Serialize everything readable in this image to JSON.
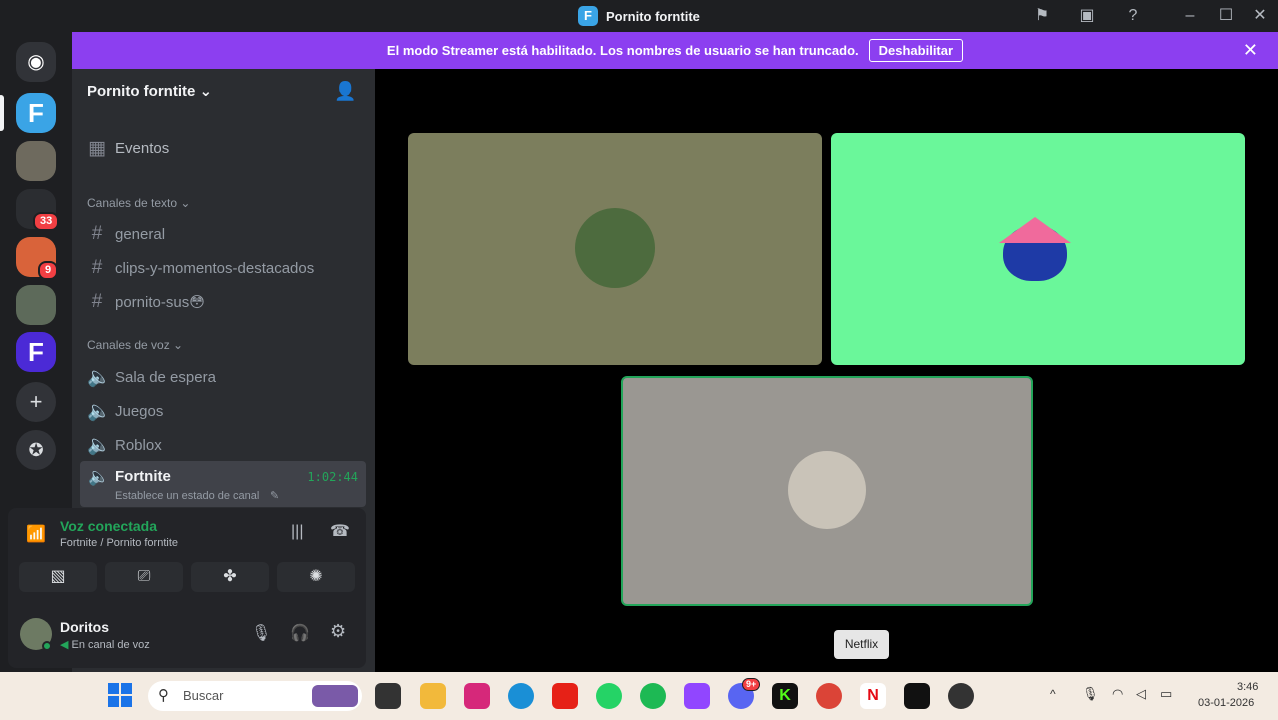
{
  "window": {
    "title": "Pornito forntite"
  },
  "banner": {
    "text": "El modo Streamer está habilitado. Los nombres de usuario se han truncado.",
    "button": "Deshabilitar"
  },
  "rail": {
    "badge_1": "33",
    "badge_2": "9"
  },
  "sidebar": {
    "server_name": "Pornito forntite",
    "events": "Eventos",
    "text_category": "Canales de texto",
    "text_channels": [
      "general",
      "clips-y-momentos-destacados",
      "pornito-sus😳"
    ],
    "voice_category": "Canales de voz",
    "voice_channels": [
      "Sala de espera",
      "Juegos",
      "Roblox"
    ],
    "active_channel": {
      "name": "Fortnite",
      "timer": "1:02:44",
      "status": "Establece un estado de canal"
    }
  },
  "voice_panel": {
    "status": "Voz conectada",
    "location": "Fortnite / Pornito forntite"
  },
  "user": {
    "name": "Doritos",
    "status": "En canal de voz"
  },
  "tooltip": "Netflix",
  "taskbar": {
    "search_placeholder": "Buscar",
    "discord_badge": "9+",
    "time": "3:46",
    "date": "03-01-2026"
  },
  "colors": {
    "accent": "#8c3ff0",
    "green": "#23a55a",
    "tile1": "#7c7e5d",
    "tile2": "#6af79a",
    "tile3": "#9a9792"
  }
}
